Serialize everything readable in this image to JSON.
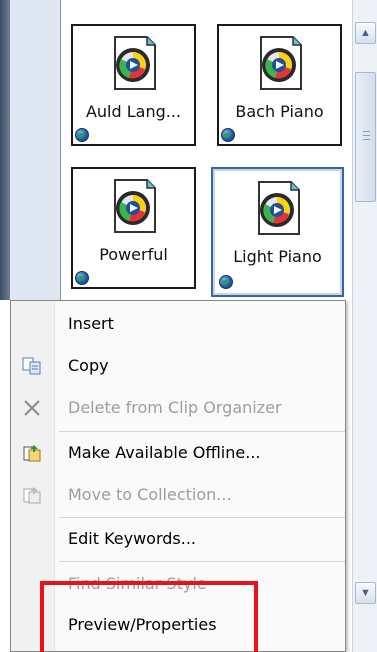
{
  "clips": [
    {
      "label": "Auld Lang..."
    },
    {
      "label": "Bach Piano"
    },
    {
      "label": "Powerful"
    },
    {
      "label": "Light Piano"
    }
  ],
  "scrollbar": {
    "up_glyph": "▲",
    "down_glyph": "▼"
  },
  "menu": {
    "items": [
      {
        "label": "Insert",
        "icon": "none",
        "enabled": true
      },
      {
        "label": "Copy",
        "icon": "copy-icon",
        "enabled": true
      },
      {
        "label": "Delete from Clip Organizer",
        "icon": "delete-x-icon",
        "enabled": false
      },
      {
        "label": "Make Available Offline...",
        "icon": "make-offline-icon",
        "enabled": true
      },
      {
        "label": "Move to Collection...",
        "icon": "move-collection-icon",
        "enabled": false
      },
      {
        "label": "Edit Keywords...",
        "icon": "none",
        "enabled": true
      },
      {
        "label": "Find Similar Style",
        "icon": "none",
        "enabled": false
      },
      {
        "label": "Preview/Properties",
        "icon": "none",
        "enabled": true
      }
    ]
  },
  "colors": {
    "highlight": "#e8121a",
    "selected_border": "#3465a4"
  }
}
